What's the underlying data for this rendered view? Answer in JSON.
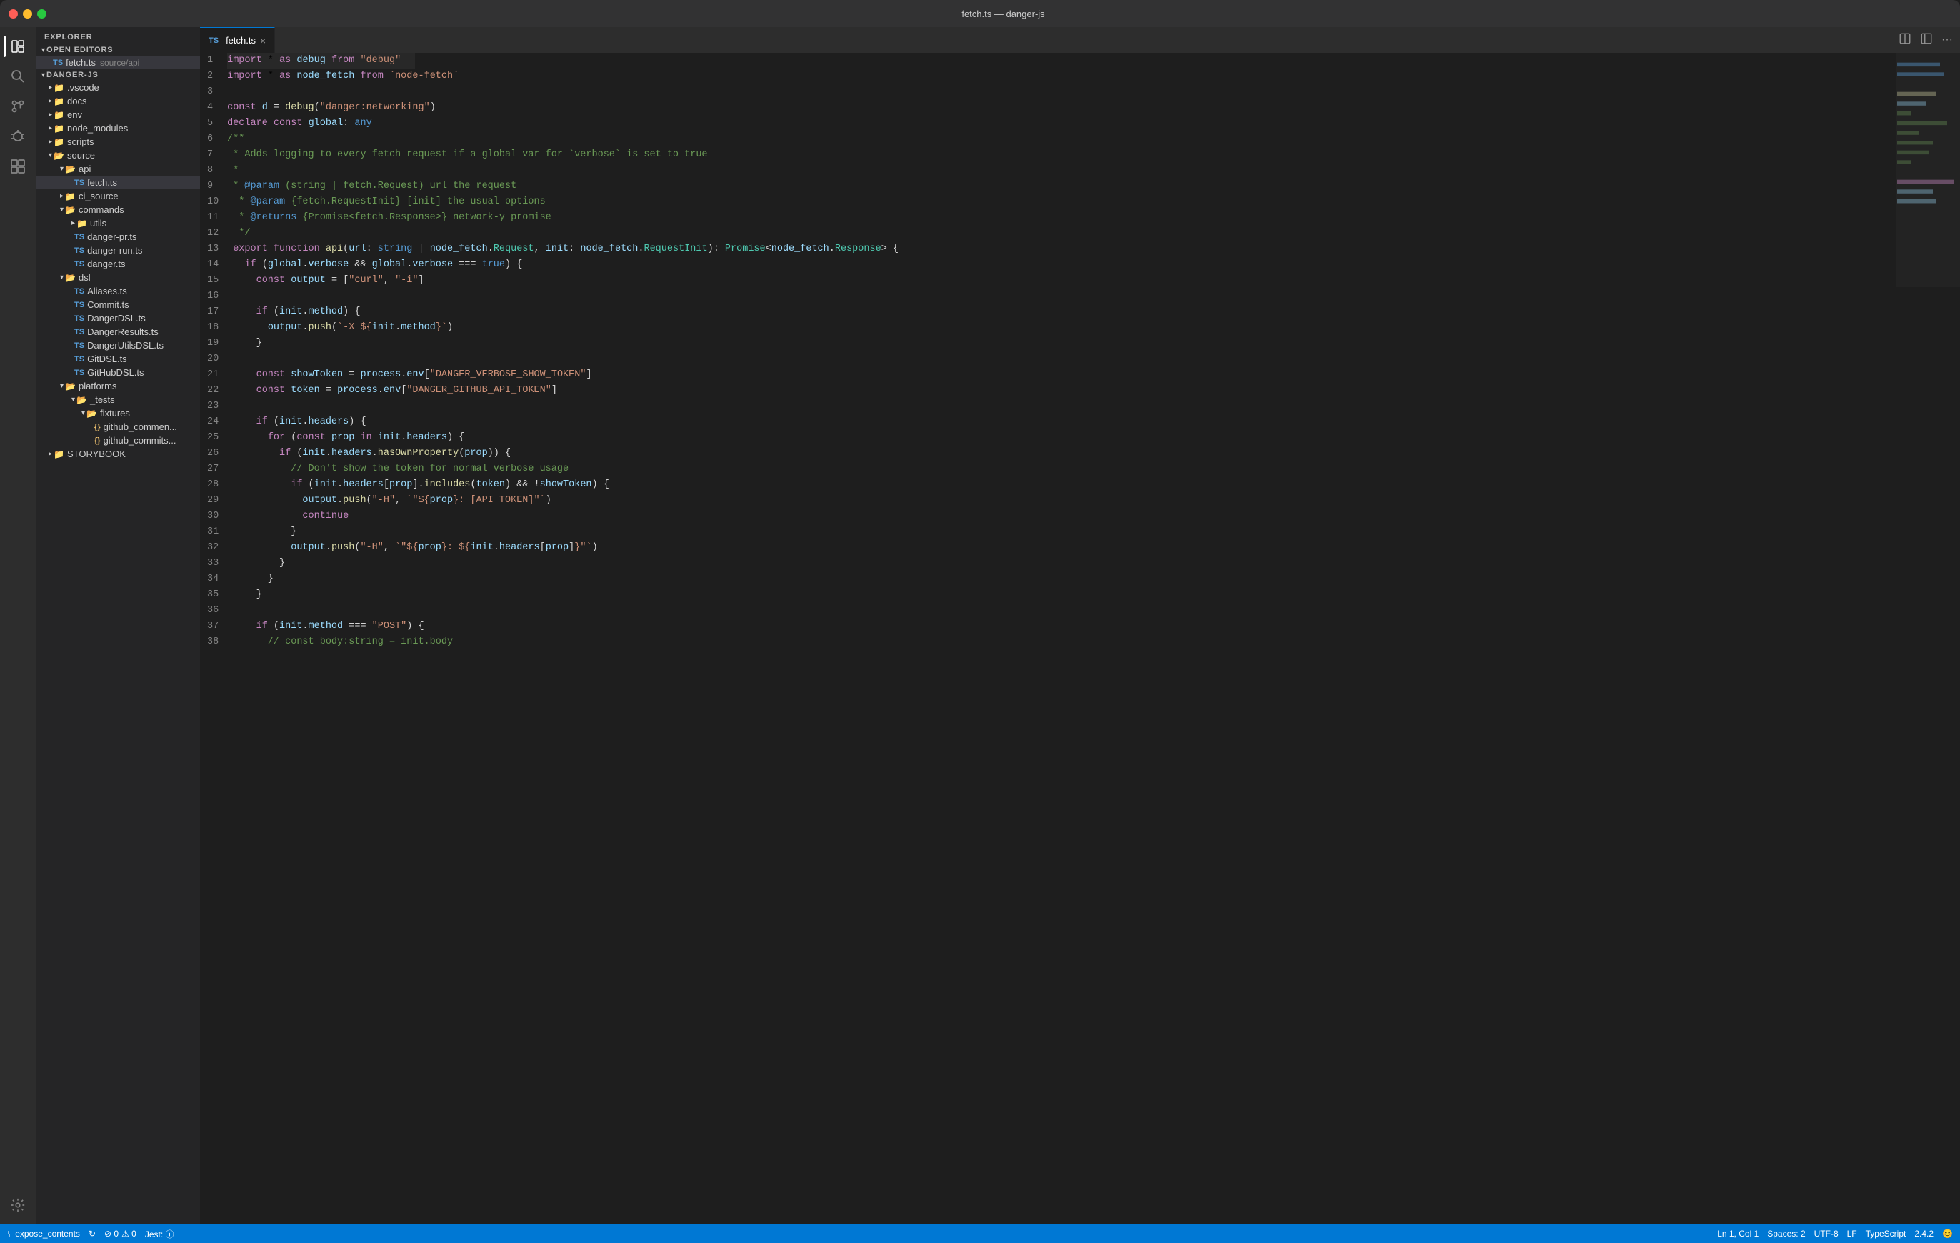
{
  "window": {
    "title": "fetch.ts — danger-js"
  },
  "activity_bar": {
    "icons": [
      {
        "name": "explorer-icon",
        "symbol": "⬜",
        "label": "Explorer",
        "active": true
      },
      {
        "name": "search-icon",
        "symbol": "🔍",
        "label": "Search",
        "active": false
      },
      {
        "name": "source-control-icon",
        "symbol": "⑂",
        "label": "Source Control",
        "active": false
      },
      {
        "name": "debug-icon",
        "symbol": "⛔",
        "label": "Debug",
        "active": false
      },
      {
        "name": "extensions-icon",
        "symbol": "⊞",
        "label": "Extensions",
        "active": false
      }
    ],
    "bottom_icon": {
      "name": "settings-icon",
      "symbol": "⚙",
      "label": "Settings"
    }
  },
  "sidebar": {
    "title": "EXPLORER",
    "sections": [
      {
        "name": "open-editors",
        "label": "OPEN EDITORS",
        "expanded": true,
        "items": [
          {
            "type": "ts",
            "label": "fetch.ts",
            "path": "source/api",
            "active": true
          }
        ]
      },
      {
        "name": "danger-js",
        "label": "DANGER-JS",
        "expanded": true,
        "items": [
          {
            "type": "folder",
            "label": ".vscode",
            "indent": 1,
            "expanded": false
          },
          {
            "type": "folder",
            "label": "docs",
            "indent": 1,
            "expanded": false
          },
          {
            "type": "folder",
            "label": "env",
            "indent": 1,
            "expanded": false
          },
          {
            "type": "folder",
            "label": "node_modules",
            "indent": 1,
            "expanded": false
          },
          {
            "type": "folder",
            "label": "scripts",
            "indent": 1,
            "expanded": false
          },
          {
            "type": "folder",
            "label": "source",
            "indent": 1,
            "expanded": true
          },
          {
            "type": "folder",
            "label": "api",
            "indent": 2,
            "expanded": true
          },
          {
            "type": "ts",
            "label": "fetch.ts",
            "indent": 3,
            "active": true
          },
          {
            "type": "folder",
            "label": "ci_source",
            "indent": 2,
            "expanded": false
          },
          {
            "type": "folder",
            "label": "commands",
            "indent": 2,
            "expanded": true
          },
          {
            "type": "folder",
            "label": "utils",
            "indent": 3,
            "expanded": false
          },
          {
            "type": "ts",
            "label": "danger-pr.ts",
            "indent": 3
          },
          {
            "type": "ts",
            "label": "danger-run.ts",
            "indent": 3
          },
          {
            "type": "ts",
            "label": "danger.ts",
            "indent": 3
          },
          {
            "type": "folder",
            "label": "dsl",
            "indent": 2,
            "expanded": true
          },
          {
            "type": "ts",
            "label": "Aliases.ts",
            "indent": 3
          },
          {
            "type": "ts",
            "label": "Commit.ts",
            "indent": 3
          },
          {
            "type": "ts",
            "label": "DangerDSL.ts",
            "indent": 3
          },
          {
            "type": "ts",
            "label": "DangerResults.ts",
            "indent": 3
          },
          {
            "type": "ts",
            "label": "DangerUtilsDSL.ts",
            "indent": 3
          },
          {
            "type": "ts",
            "label": "GitDSL.ts",
            "indent": 3
          },
          {
            "type": "ts",
            "label": "GitHubDSL.ts",
            "indent": 3
          },
          {
            "type": "folder",
            "label": "platforms",
            "indent": 2,
            "expanded": true
          },
          {
            "type": "folder",
            "label": "_tests",
            "indent": 3,
            "expanded": true
          },
          {
            "type": "folder",
            "label": "fixtures",
            "indent": 4,
            "expanded": true
          },
          {
            "type": "json",
            "label": "github_commen...",
            "indent": 5
          },
          {
            "type": "json",
            "label": "github_commits...",
            "indent": 5
          },
          {
            "type": "folder",
            "label": "STORYBOOK",
            "indent": 1,
            "expanded": false
          }
        ]
      }
    ]
  },
  "tabs": [
    {
      "name": "fetch-ts-tab",
      "label": "fetch.ts",
      "type": "ts",
      "active": true,
      "closeable": true
    }
  ],
  "tab_actions": [
    {
      "name": "split-editor-icon",
      "symbol": "⧉"
    },
    {
      "name": "toggle-sidebar-icon",
      "symbol": "▣"
    },
    {
      "name": "more-actions-icon",
      "symbol": "···"
    }
  ],
  "code": {
    "filename": "fetch.ts",
    "lines": [
      {
        "num": 1,
        "active": true,
        "content": "import_kw * as debug_var from_kw \"debug\"_str"
      },
      {
        "num": 2,
        "content": "import_kw * as node_fetch_var from_kw `node-fetch`_str"
      },
      {
        "num": 3,
        "content": ""
      },
      {
        "num": 4,
        "content": "const_kw d_var = debug_fn(\"danger:networking\"_str)"
      },
      {
        "num": 5,
        "content": "declare_kw const_kw global_var: any_kw2"
      },
      {
        "num": 6,
        "content": "/**_cm"
      },
      {
        "num": 7,
        "content": " * Adds logging to every fetch request if a global var for `verbose` is set to true_cm"
      },
      {
        "num": 8,
        "content": " *_cm"
      },
      {
        "num": 9,
        "content": " * @param (string | fetch.Request) url the request_cm"
      },
      {
        "num": 10,
        "content": " * @param {fetch.RequestInit} [init] the usual options_cm"
      },
      {
        "num": 11,
        "content": " * @returns {Promise<fetch.Response>} network-y promise_cm"
      },
      {
        "num": 12,
        "content": " */_cm"
      },
      {
        "num": 13,
        "content": "export_kw function_kw api_fn(url_var: string_kw2 | node_fetch_var.Request_tp, init_var: node_fetch_var.RequestInit_tp): Promise_tp<node_fetch_var.Response_tp> {"
      },
      {
        "num": 14,
        "content": "  if_kw (global_var.verbose_prop && global_var.verbose_prop === true_kw2) {"
      },
      {
        "num": 15,
        "content": "    const_kw output_var = [\"curl\"_str, \"-i\"_str]"
      },
      {
        "num": 16,
        "content": ""
      },
      {
        "num": 17,
        "content": "    if_kw (init_var.method_prop) {"
      },
      {
        "num": 18,
        "content": "      output_var.push_fn(`-X ${init_var.method_prop}`_tmpl)"
      },
      {
        "num": 19,
        "content": "    }"
      },
      {
        "num": 20,
        "content": ""
      },
      {
        "num": 21,
        "content": "    const_kw showToken_var = process_var.env_prop[\"DANGER_VERBOSE_SHOW_TOKEN\"_str]"
      },
      {
        "num": 22,
        "content": "    const_kw token_var = process_var.env_prop[\"DANGER_GITHUB_API_TOKEN\"_str]"
      },
      {
        "num": 23,
        "content": ""
      },
      {
        "num": 24,
        "content": "    if_kw (init_var.headers_prop) {"
      },
      {
        "num": 25,
        "content": "      for_kw (const_kw prop_var in_kw init_var.headers_prop) {"
      },
      {
        "num": 26,
        "content": "        if_kw (init_var.headers_prop.hasOwnProperty_fn(prop_var)) {"
      },
      {
        "num": 27,
        "content": "          // Don't show the token for normal verbose usage_cm"
      },
      {
        "num": 28,
        "content": "          if_kw (init_var.headers_prop[prop_var].includes_fn(token_var) && !showToken_var) {"
      },
      {
        "num": 29,
        "content": "            output_var.push_fn(\"-H\"_str, `\"${prop_var}: [API TOKEN]\"`_tmpl)"
      },
      {
        "num": 30,
        "content": "            continue_kw"
      },
      {
        "num": 31,
        "content": "          }"
      },
      {
        "num": 32,
        "content": "          output_var.push_fn(\"-H\"_str, `\"${prop_var}: ${init_var.headers_prop[prop_var]}\"`_tmpl)"
      },
      {
        "num": 33,
        "content": "        }"
      },
      {
        "num": 34,
        "content": "      }"
      },
      {
        "num": 35,
        "content": "    }"
      },
      {
        "num": 36,
        "content": ""
      },
      {
        "num": 37,
        "content": "    if_kw (init_var.method_prop === \"POST\"_str) {"
      },
      {
        "num": 38,
        "content": "      // const body:string = init.body_cm"
      }
    ]
  },
  "status_bar": {
    "branch_icon": "⑂",
    "branch": "expose_contents",
    "sync_icon": "↻",
    "errors": "⊘ 0",
    "warnings": "⚠ 0",
    "jest": "Jest: ⓘ",
    "position": "Ln 1, Col 1",
    "spaces": "Spaces: 2",
    "encoding": "UTF-8",
    "line_ending": "LF",
    "language": "TypeScript",
    "version": "2.4.2",
    "emoji": "😊"
  }
}
